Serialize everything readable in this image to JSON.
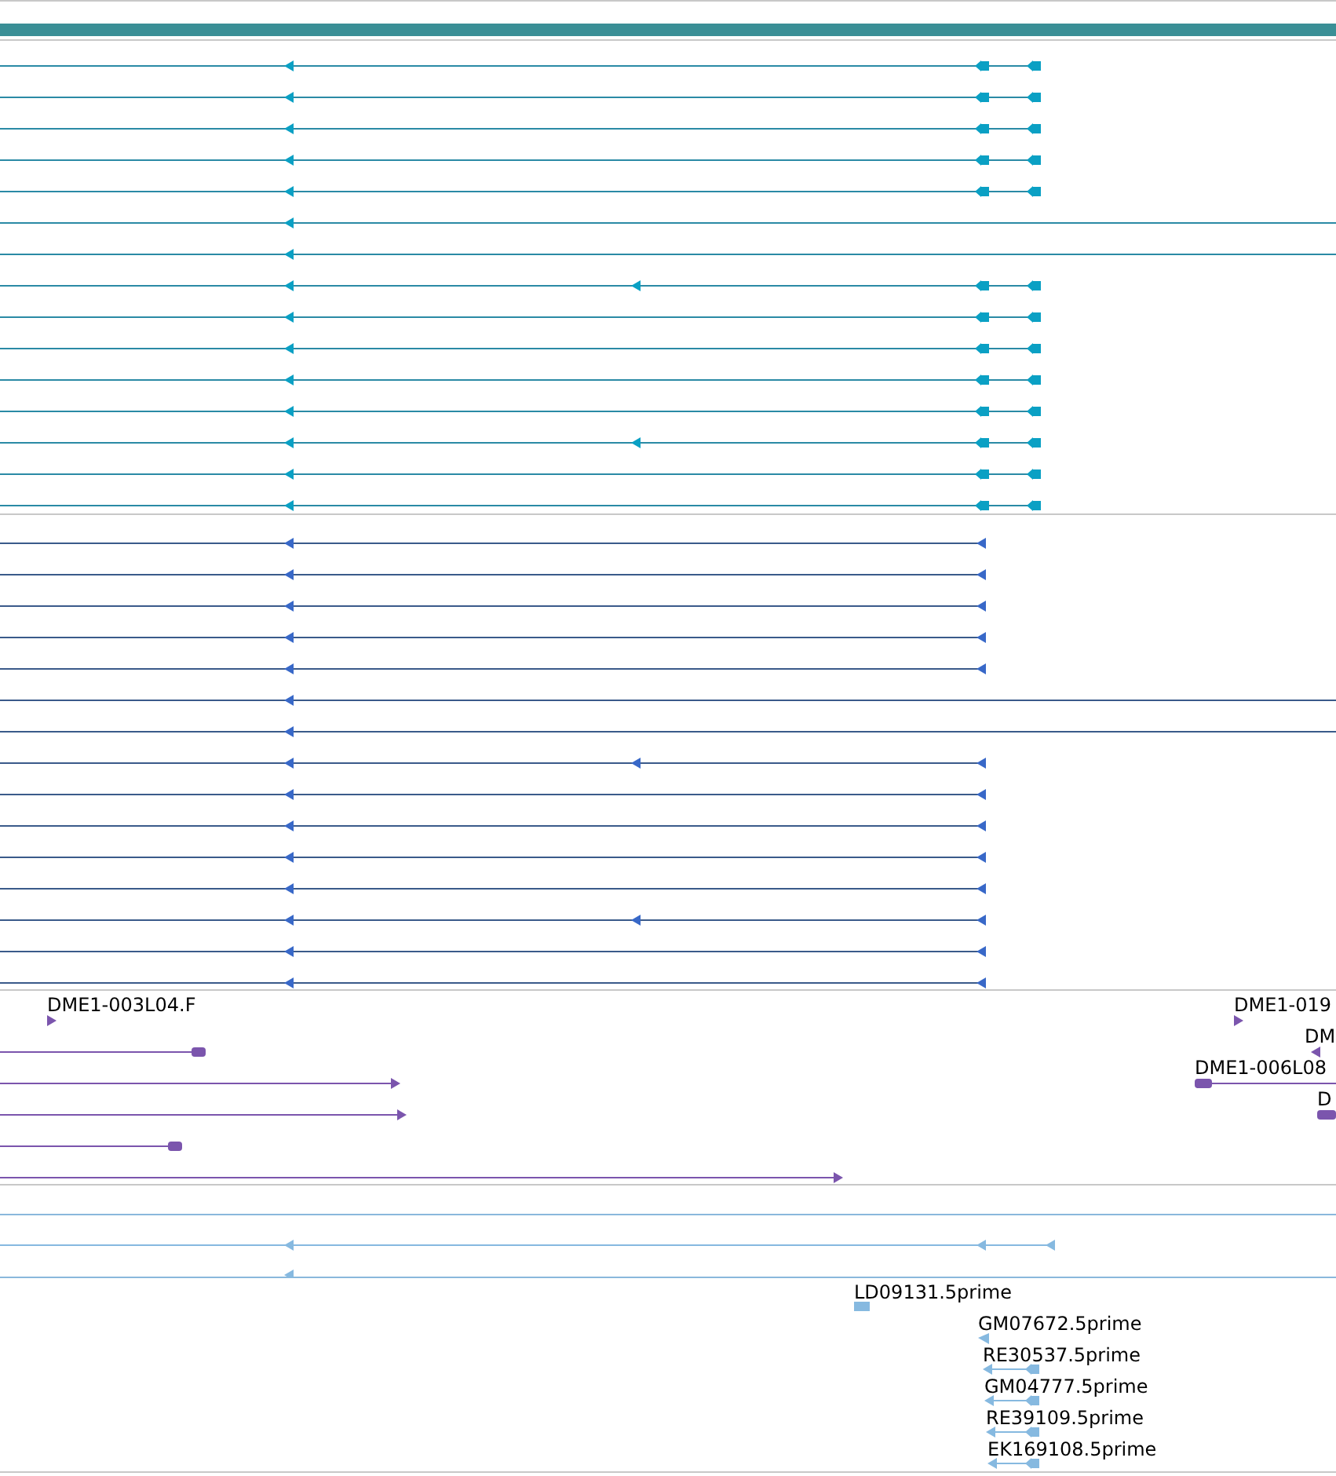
{
  "clone_track": {
    "labels": [
      "DME1-003L04.F",
      "DME1-019",
      "DM",
      "DME1-006L08",
      "D"
    ]
  },
  "est_track": {
    "labels": [
      "LD09131.5prime",
      "GM07672.5prime",
      "RE30537.5prime",
      "GM04777.5prime",
      "RE39109.5prime",
      "EK169108.5prime"
    ]
  }
}
